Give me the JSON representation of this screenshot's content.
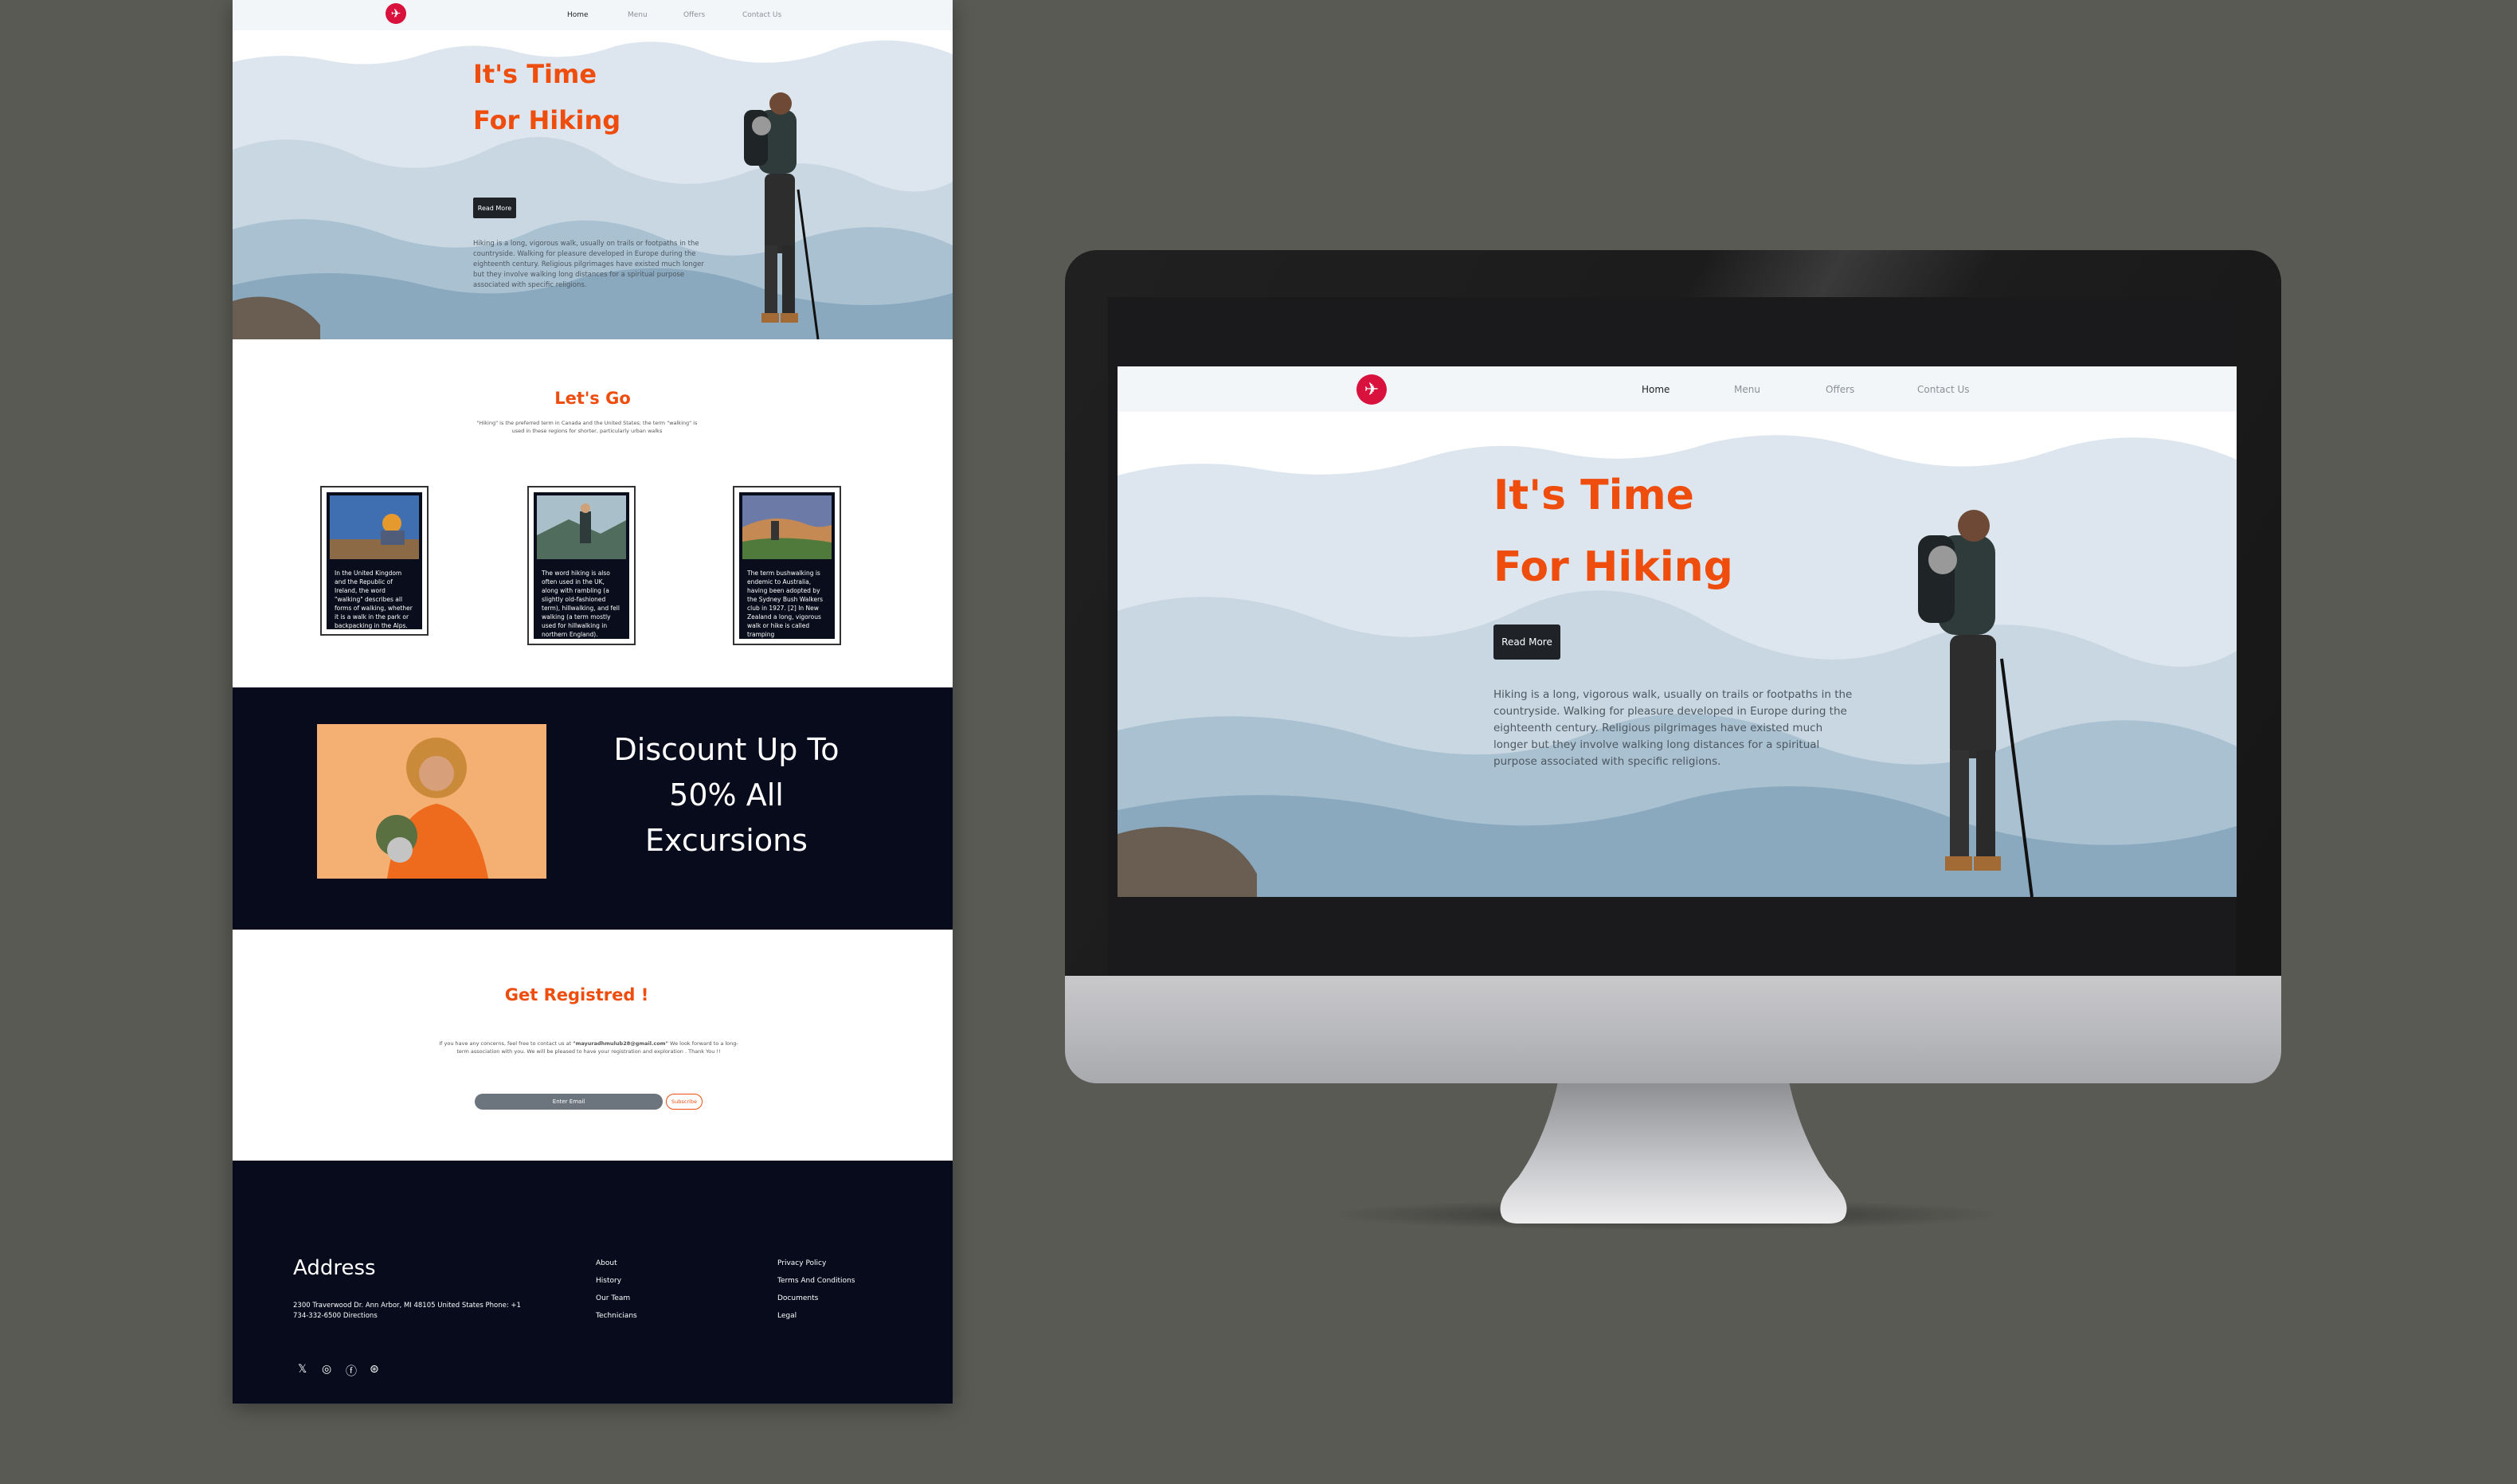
{
  "site": {
    "nav": {
      "items": [
        "Home",
        "Menu",
        "Offers",
        "Contact Us"
      ],
      "active": "Home",
      "logo_icon": "plane-icon"
    },
    "hero": {
      "title_line1": "It's Time",
      "title_line2": "For Hiking",
      "button_label": "Read More",
      "paragraph": "Hiking is a long, vigorous walk, usually on trails or footpaths in the countryside. Walking for pleasure developed in Europe during the eighteenth century. Religious pilgrimages have existed much longer but they involve walking long distances for a spiritual purpose associated with specific religions."
    },
    "lets_go": {
      "title": "Let's Go",
      "subtitle": "\"Hiking\" is the preferred term in Canada and the United States; the term \"walking\" is used in these regions for shorter, particularly urban walks",
      "cards": [
        {
          "text": "In the United Kingdom and the Republic of Ireland, the word \"walking\" describes all forms of walking, whether it is a walk in the park or backpacking in the Alps."
        },
        {
          "text": "The word hiking is also often used in the UK, along with rambling (a slightly old-fashioned term), hillwalking, and fell walking (a term mostly used for hillwalking in northern England)."
        },
        {
          "text": "The term bushwalking is endemic to Australia, having been adopted by the Sydney Bush Walkers club in 1927. [2] In New Zealand a long, vigorous walk or hike is called tramping"
        }
      ]
    },
    "discount": {
      "line1": "Discount Up To",
      "line2": "50% All",
      "line3": "Excursions"
    },
    "register": {
      "title": "Get Registred !",
      "text_before": "If you have any concerns, feel free to contact us at",
      "email": "\"mayuradhmulub28@gmail.com\"",
      "text_after": "We look forward to a long-term association with you. We will be pleased to have your registration and exploration . Thank You !!",
      "input_placeholder": "Enter Email",
      "subscribe_label": "Subscribe"
    },
    "footer": {
      "address_title": "Address",
      "address_text": "2300 Traverwood Dr. Ann Arbor, MI 48105 United States Phone: +1 734-332-6500 Directions",
      "links_col1": [
        "About",
        "History",
        "Our Team",
        "Technicians"
      ],
      "links_col2": [
        "Privacy Policy",
        "Terms And Conditions",
        "Documents",
        "Legal"
      ],
      "social_icons": [
        "twitter-icon",
        "instagram-icon",
        "facebook-icon",
        "github-icon"
      ]
    }
  },
  "colors": {
    "background": "#5a5a55",
    "accent": "#ee4d0e",
    "logo": "#d8123c",
    "dark": "#070b1c",
    "button": "#1f2328"
  }
}
